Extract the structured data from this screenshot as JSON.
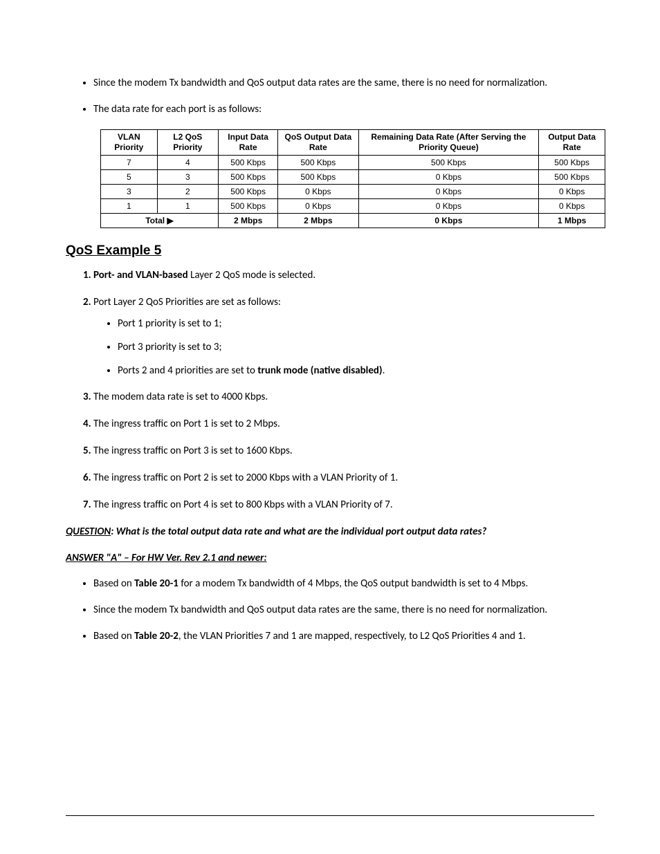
{
  "bullets_top": {
    "b1": "Since the modem Tx bandwidth and QoS output data rates are the same, there is no need for normalization.",
    "b2": "The data rate for each port is as follows:"
  },
  "table": {
    "headers": {
      "c1": "VLAN Priority",
      "c2": "L2 QoS Priority",
      "c3": "Input Data Rate",
      "c4": "QoS Output Data Rate",
      "c5": "Remaining Data Rate (After Serving the Priority Queue)",
      "c6": "Output Data Rate"
    },
    "rows": [
      {
        "c1": "7",
        "c2": "4",
        "c3": "500 Kbps",
        "c4": "500 Kbps",
        "c5": "500 Kbps",
        "c6": "500 Kbps"
      },
      {
        "c1": "5",
        "c2": "3",
        "c3": "500 Kbps",
        "c4": "500 Kbps",
        "c5": "0 Kbps",
        "c6": "500 Kbps"
      },
      {
        "c1": "3",
        "c2": "2",
        "c3": "500 Kbps",
        "c4": "0 Kbps",
        "c5": "0 Kbps",
        "c6": "0 Kbps"
      },
      {
        "c1": "1",
        "c2": "1",
        "c3": "500 Kbps",
        "c4": "0 Kbps",
        "c5": "0 Kbps",
        "c6": "0 Kbps"
      }
    ],
    "total": {
      "label": "Total ▶",
      "c3": "2 Mbps",
      "c4": "2 Mbps",
      "c5": "0 Kbps",
      "c6": "1 Mbps"
    }
  },
  "heading": "QoS Example 5",
  "list": {
    "i1_pre": "Port- and VLAN-based",
    "i1_post": " Layer 2 QoS mode is selected.",
    "i2": "Port Layer 2 QoS Priorities are set as follows:",
    "i2_sub": {
      "s1": "Port 1 priority is set to 1;",
      "s2": "Port 3 priority is set to 3;",
      "s3_pre": "Ports 2 and 4 priorities are set to ",
      "s3_bold": "trunk mode (native disabled)",
      "s3_post": "."
    },
    "i3": "The modem data rate is set to 4000 Kbps.",
    "i4": "The ingress traffic on Port 1 is set to 2 Mbps.",
    "i5": "The ingress traffic on Port 3 is set to 1600 Kbps.",
    "i6": "The ingress traffic on Port 2 is set to 2000 Kbps with a VLAN Priority of 1.",
    "i7": "The ingress traffic on Port 4 is set to 800 Kbps with a VLAN Priority of 7."
  },
  "question": {
    "label": "QUESTION",
    "text": ": What is the total output data rate and what are the individual port output data rates?"
  },
  "answer_head": "ANSWER \"A\" – For HW Ver. Rev 2.1 and newer:",
  "answer_bullets": {
    "a1_pre": "Based on ",
    "a1_bold": "Table 20-1",
    "a1_post": " for a modem Tx bandwidth of 4 Mbps, the QoS output bandwidth is set to 4 Mbps.",
    "a2": "Since the modem Tx bandwidth and QoS output data rates are the same, there is no need for normalization.",
    "a3_pre": "Based on ",
    "a3_bold": "Table 20-2",
    "a3_post": ", the VLAN Priorities 7 and 1 are mapped, respectively, to L2 QoS Priorities 4 and 1."
  }
}
